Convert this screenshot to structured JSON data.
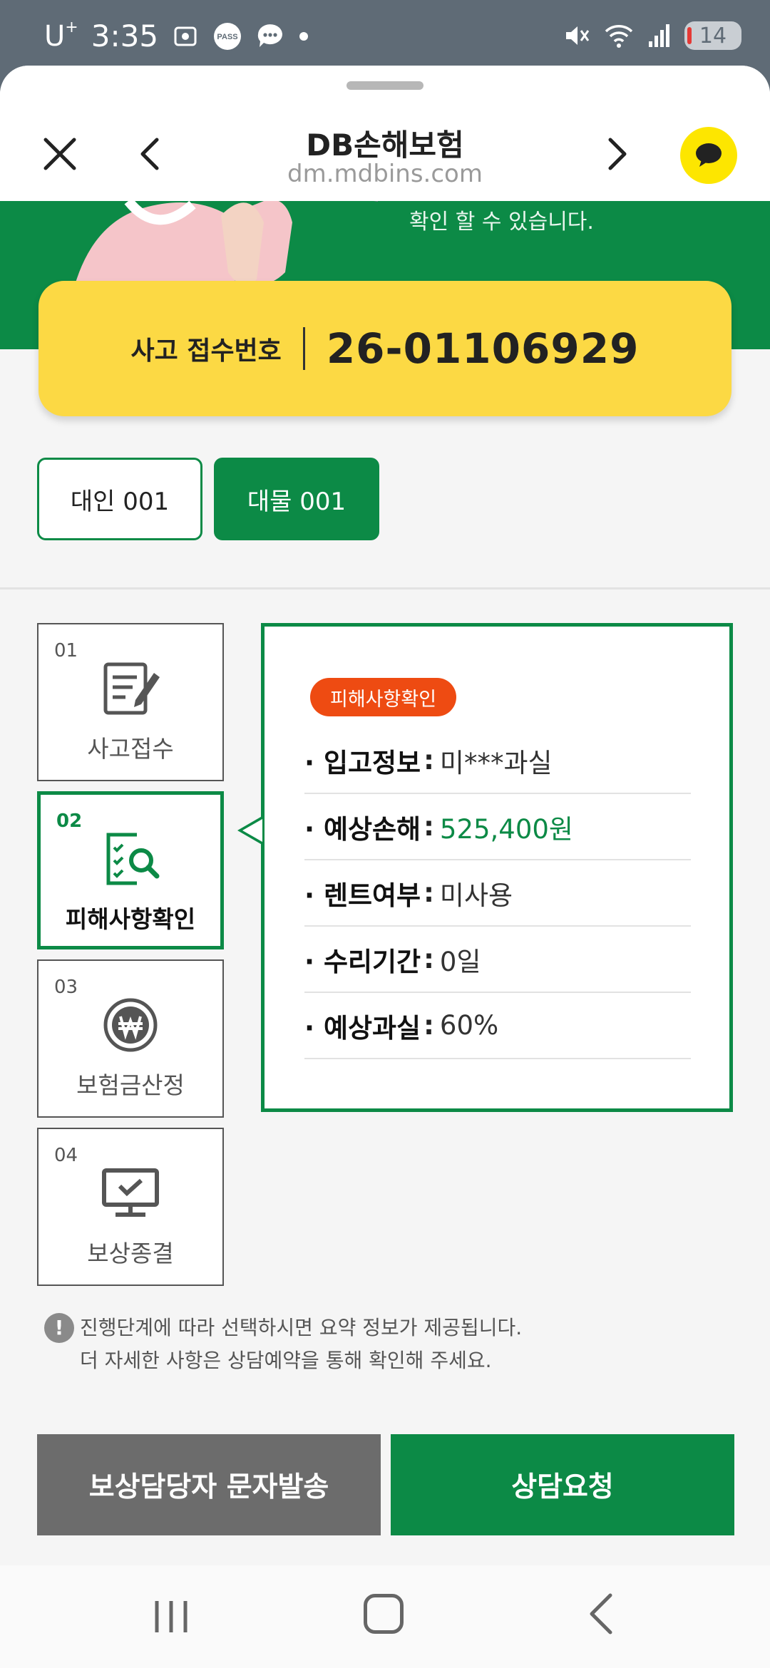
{
  "status_bar": {
    "carrier": "U",
    "carrier_sup": "+",
    "time": "3:35",
    "pass_label": "PASS",
    "battery": "14"
  },
  "browser": {
    "title": "DB손해보험",
    "url": "dm.mdbins.com"
  },
  "banner": {
    "text": "확인 할 수 있습니다."
  },
  "accident": {
    "label": "사고 접수번호",
    "number": "26-01106929"
  },
  "tabs": [
    {
      "label": "대인 001",
      "active": false
    },
    {
      "label": "대물 001",
      "active": true
    }
  ],
  "steps": [
    {
      "num": "01",
      "label": "사고접수",
      "icon": "document-edit-icon"
    },
    {
      "num": "02",
      "label": "피해사항확인",
      "icon": "document-search-icon"
    },
    {
      "num": "03",
      "label": "보험금산정",
      "icon": "won-coin-icon"
    },
    {
      "num": "04",
      "label": "보상종결",
      "icon": "monitor-check-icon"
    }
  ],
  "info": {
    "badge": "피해사항확인",
    "rows": [
      {
        "key": "입고정보",
        "value": "미***과실"
      },
      {
        "key": "예상손해",
        "value": "525,400원"
      },
      {
        "key": "렌트여부",
        "value": "미사용"
      },
      {
        "key": "수리기간",
        "value": "0일"
      },
      {
        "key": "예상과실",
        "value": "60%"
      }
    ]
  },
  "notice": {
    "icon": "!",
    "line1": "진행단계에 따라 선택하시면 요약 정보가 제공됩니다.",
    "line2": "더 자세한 사항은 상담예약을 통해 확인해 주세요."
  },
  "buttons": {
    "sms": "보상담당자 문자발송",
    "consult": "상담요청"
  },
  "colors": {
    "brand_green": "#0c8a46",
    "accent_yellow": "#fcd944",
    "badge_orange": "#ee4b12",
    "kakao_yellow": "#fde600"
  }
}
